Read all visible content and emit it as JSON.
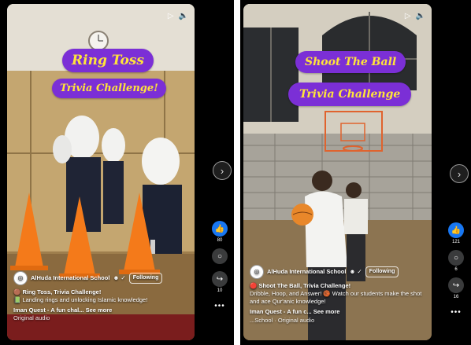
{
  "reels": [
    {
      "title_line1": "Ring Toss",
      "title_line2": "Trivia Challenge!",
      "channel_name": "AlHuda International School",
      "channel_badge": "☻ ✓",
      "follow_label": "Following",
      "caption_line1": "Ring Toss, Trivia Challenge!",
      "caption_line1_prefix": "🟤",
      "caption_line2": "Landing rings and unlocking Islamic knowledge!",
      "caption_line2_prefix": "📗",
      "music_prefix": "Iman Quest - A fun chal...",
      "see_more": "See more",
      "audio_label": "Original audio",
      "likes": "80",
      "comments": "",
      "shares": "10"
    },
    {
      "title_line1": "Shoot The Ball",
      "title_line2": "Trivia Challenge",
      "channel_name": "AlHuda International School",
      "channel_badge": "☻ ✓",
      "follow_label": "Following",
      "caption_line1": "Shoot The Ball, Trivia Challenge!",
      "caption_line1_prefix": "🔴",
      "caption_line2": "Dribble, Hoop, and Answer! 🏀 Watch our students make the shot and ace Qur'anic knowledge!",
      "caption_line2_prefix": "",
      "music_prefix": "Iman Quest - A fun c... See more",
      "see_more": "",
      "audio_label": "...School · Original audio",
      "likes": "121",
      "comments": "6",
      "shares": "16"
    }
  ],
  "icons": {
    "play": "▷",
    "mute": "🔈",
    "next": "›",
    "like": "👍",
    "comment": "○",
    "share": "↪",
    "more": "•••"
  },
  "colors": {
    "title_pill_bg": "#7b2fd6",
    "title_text": "#ffe43a",
    "like_blue": "#1877f2",
    "cone_orange": "#f47a1a"
  }
}
